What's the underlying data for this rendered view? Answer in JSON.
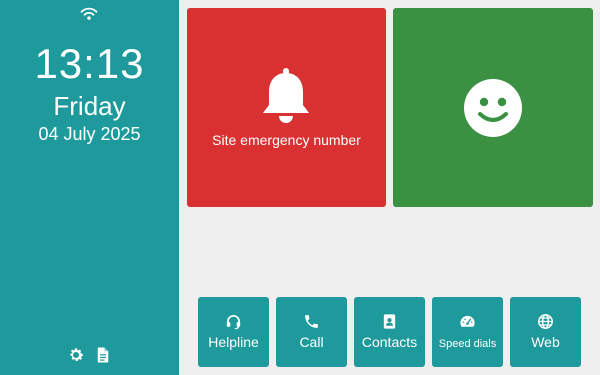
{
  "clock": {
    "time": "13:13",
    "day": "Friday",
    "date": "04 July 2025"
  },
  "tiles": {
    "emergency": {
      "label": "Site emergency number",
      "icon": "bell-icon",
      "color": "#d93031"
    },
    "wellbeing": {
      "icon": "smiley-face-icon",
      "color": "#3a9141"
    }
  },
  "quick_buttons": [
    {
      "label": "Helpline",
      "icon": "headset-icon"
    },
    {
      "label": "Call",
      "icon": "phone-icon"
    },
    {
      "label": "Contacts",
      "icon": "address-book-icon"
    },
    {
      "label": "Speed dials",
      "icon": "gauge-icon"
    },
    {
      "label": "Web",
      "icon": "globe-icon"
    }
  ],
  "sidebar_icons": [
    "settings-icon",
    "document-icon"
  ],
  "status": {
    "wifi": "wifi-icon"
  },
  "colors": {
    "accent": "#1e9a9c",
    "background": "#efefef"
  }
}
